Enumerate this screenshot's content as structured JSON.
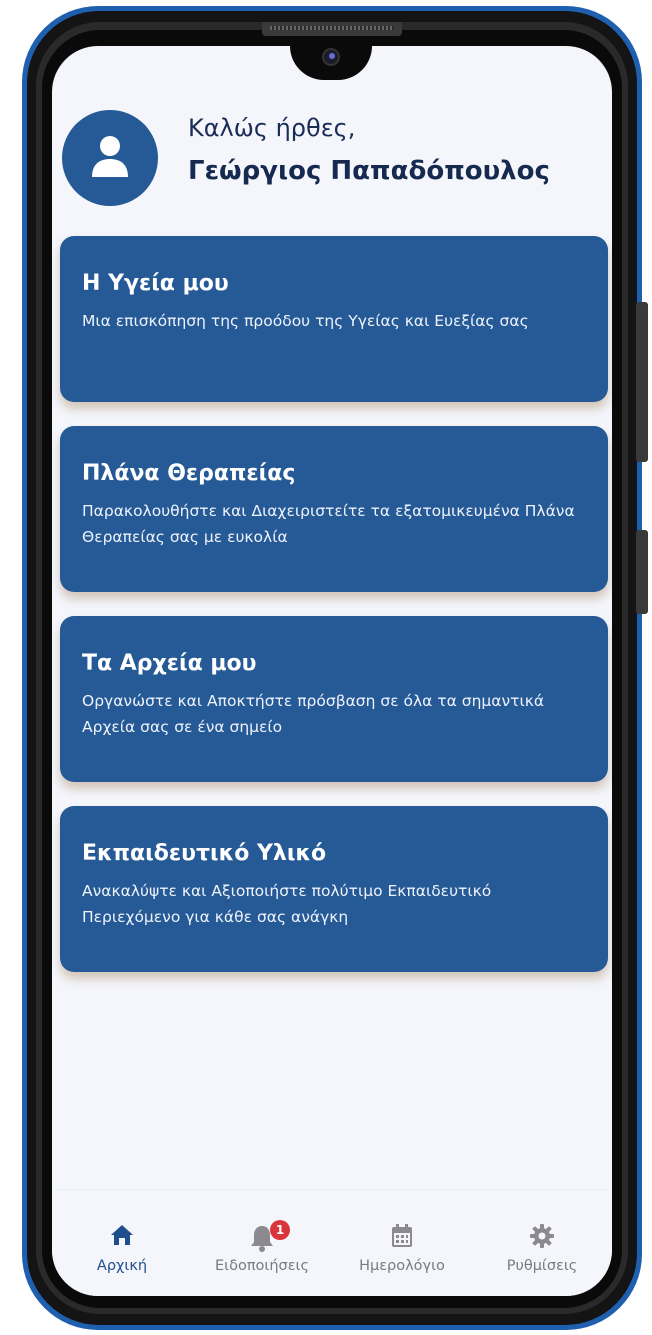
{
  "header": {
    "welcome": "Καλώς ήρθες,",
    "username": "Γεώργιος Παπαδόπουλος"
  },
  "cards": [
    {
      "title": "Η Υγεία μου",
      "description": "Μια επισκόπηση της προόδου της Υγείας και Ευεξίας σας"
    },
    {
      "title": "Πλάνα Θεραπείας",
      "description": "Παρακολουθήστε και Διαχειριστείτε τα εξατομικευμένα Πλάνα Θεραπείας σας με ευκολία"
    },
    {
      "title": "Τα Αρχεία μου",
      "description": "Οργανώστε και Αποκτήστε πρόσβαση σε όλα τα σημαντικά Αρχεία σας σε ένα σημείο"
    },
    {
      "title": "Εκπαιδευτικό Υλικό",
      "description": "Ανακαλύψτε και Αξιοποιήστε πολύτιμο Εκπαιδευτικό Περιεχόμενο για κάθε σας ανάγκη"
    }
  ],
  "nav": {
    "home": {
      "label": "Αρχική",
      "icon": "home-icon",
      "active": true
    },
    "notifications": {
      "label": "Ειδοποιήσεις",
      "icon": "bell-icon",
      "badge": "1"
    },
    "calendar": {
      "label": "Ημερολόγιο",
      "icon": "calendar-icon"
    },
    "settings": {
      "label": "Ρυθμίσεις",
      "icon": "gear-icon"
    }
  },
  "colors": {
    "primary": "#255a96",
    "background": "#f4f6fc",
    "badge": "#d9353b",
    "frame": "#1f5fb0"
  }
}
